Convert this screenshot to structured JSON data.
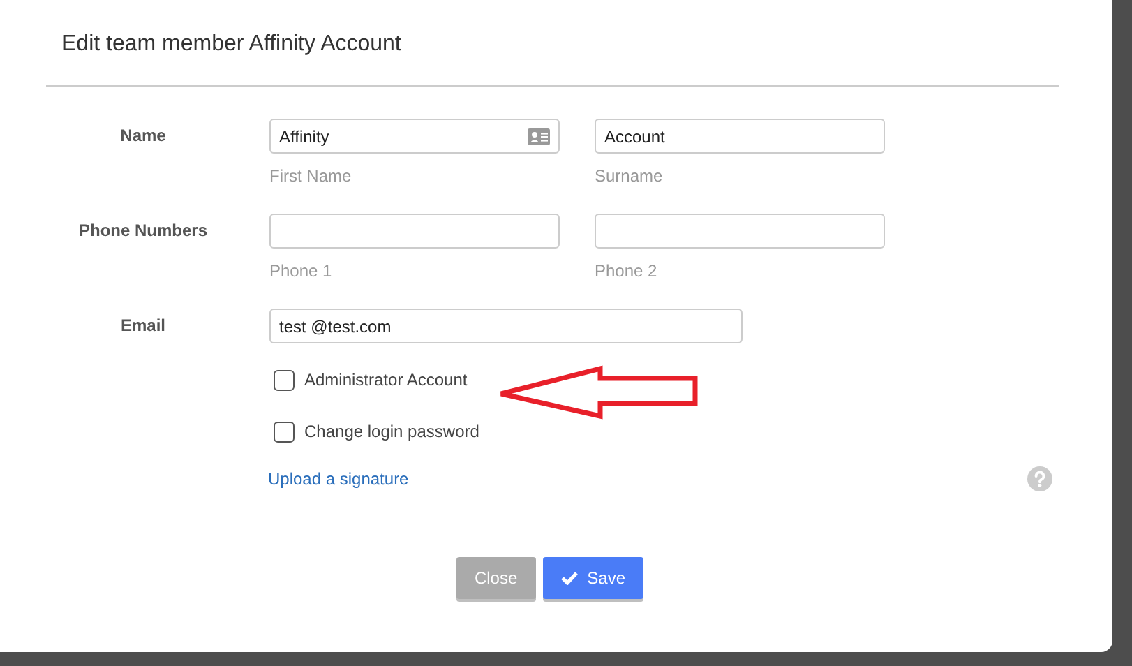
{
  "dialog": {
    "title": "Edit team member Affinity Account",
    "rows": [
      {
        "label": "Name",
        "inputs": [
          {
            "value": "Affinity",
            "hint": "First Name",
            "kind": "contact"
          },
          {
            "value": "Account",
            "hint": "Surname",
            "kind": "plain"
          }
        ]
      },
      {
        "label": "Phone Numbers",
        "inputs": [
          {
            "hint": "Phone 1",
            "kind": "plain"
          },
          {
            "hint": "Phone 2",
            "kind": "plain"
          }
        ]
      },
      {
        "label": "Email",
        "inputs": [
          {
            "value": "test @test.com",
            "kind": "wide"
          }
        ]
      }
    ],
    "checkboxes": [
      {
        "label": "Administrator Account",
        "checked": false
      },
      {
        "label": "Change login password",
        "checked": false
      }
    ],
    "link": "Upload a signature",
    "buttons": [
      {
        "label": "Close",
        "kind": "secondary"
      },
      {
        "label": "Save",
        "kind": "primary"
      }
    ]
  }
}
